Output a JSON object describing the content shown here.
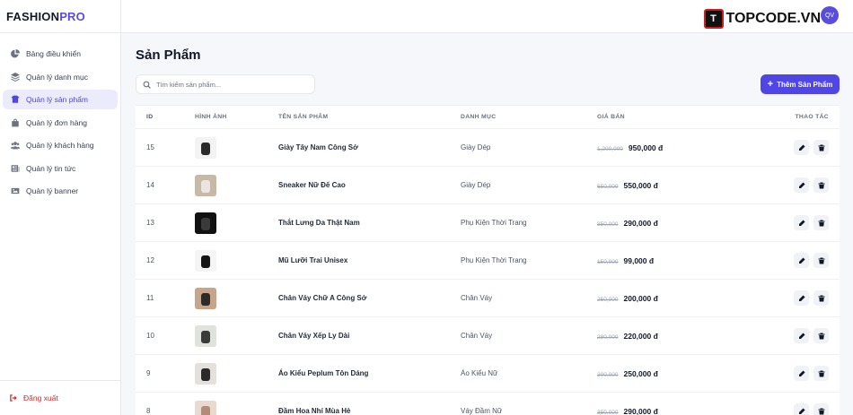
{
  "app": {
    "logo_main": "FASHION",
    "logo_accent": "PRO"
  },
  "sidebar": {
    "items": [
      {
        "label": "Bảng điều khiển",
        "icon": "chart-pie-icon",
        "active": false
      },
      {
        "label": "Quản lý danh mục",
        "icon": "layers-icon",
        "active": false
      },
      {
        "label": "Quản lý sản phẩm",
        "icon": "box-icon",
        "active": true
      },
      {
        "label": "Quản lý đơn hàng",
        "icon": "shopping-bag-icon",
        "active": false
      },
      {
        "label": "Quản lý khách hàng",
        "icon": "users-icon",
        "active": false
      },
      {
        "label": "Quản lý tin tức",
        "icon": "newspaper-icon",
        "active": false
      },
      {
        "label": "Quản lý banner",
        "icon": "image-icon",
        "active": false
      }
    ],
    "logout_label": "Đăng xuất"
  },
  "topbar": {
    "avatar_initials": "QV",
    "brand_mark": "T",
    "brand_text": "TOPCODE.VN"
  },
  "page": {
    "title": "Sản Phẩm",
    "search_placeholder": "Tìm kiếm sản phẩm...",
    "add_button_label": "Thêm Sản Phẩm"
  },
  "table": {
    "columns": {
      "id": "ID",
      "image": "HÌNH ẢNH",
      "name": "TÊN SẢN PHẨM",
      "category": "DANH MỤC",
      "price": "GIÁ BÁN",
      "actions": "THAO TÁC"
    },
    "rows": [
      {
        "id": "15",
        "name": "Giày Tây Nam Công Sở",
        "category": "Giày Dép",
        "old_price": "1,200,000",
        "price": "950,000 đ",
        "thumb_color": "#2b2b2b",
        "thumb_bg": "#f3f3f3"
      },
      {
        "id": "14",
        "name": "Sneaker Nữ Đế Cao",
        "category": "Giày Dép",
        "old_price": "650,000",
        "price": "550,000 đ",
        "thumb_color": "#e9e6e0",
        "thumb_bg": "#c8b9a6"
      },
      {
        "id": "13",
        "name": "Thắt Lưng Da Thật Nam",
        "category": "Phụ Kiện Thời Trang",
        "old_price": "350,000",
        "price": "290,000 đ",
        "thumb_color": "#3a3a3a",
        "thumb_bg": "#111111"
      },
      {
        "id": "12",
        "name": "Mũ Lưỡi Trai Unisex",
        "category": "Phụ Kiện Thời Trang",
        "old_price": "150,000",
        "price": "99,000 đ",
        "thumb_color": "#151515",
        "thumb_bg": "#f5f5f5"
      },
      {
        "id": "11",
        "name": "Chân Váy Chữ A Công Sở",
        "category": "Chân Váy",
        "old_price": "250,000",
        "price": "200,000 đ",
        "thumb_color": "#2e2a27",
        "thumb_bg": "#c7a58a"
      },
      {
        "id": "10",
        "name": "Chân Váy Xếp Ly Dài",
        "category": "Chân Váy",
        "old_price": "280,000",
        "price": "220,000 đ",
        "thumb_color": "#3b3b3b",
        "thumb_bg": "#dfe3dc"
      },
      {
        "id": "9",
        "name": "Áo Kiểu Peplum Tôn Dáng",
        "category": "Áo Kiểu Nữ",
        "old_price": "300,000",
        "price": "250,000 đ",
        "thumb_color": "#2a2a2a",
        "thumb_bg": "#e4e1dc"
      },
      {
        "id": "8",
        "name": "Đầm Hoa Nhí Mùa Hè",
        "category": "Váy Đầm Nữ",
        "old_price": "350,000",
        "price": "290,000 đ",
        "thumb_color": "#b48a7a",
        "thumb_bg": "#e9d9cf"
      }
    ]
  }
}
